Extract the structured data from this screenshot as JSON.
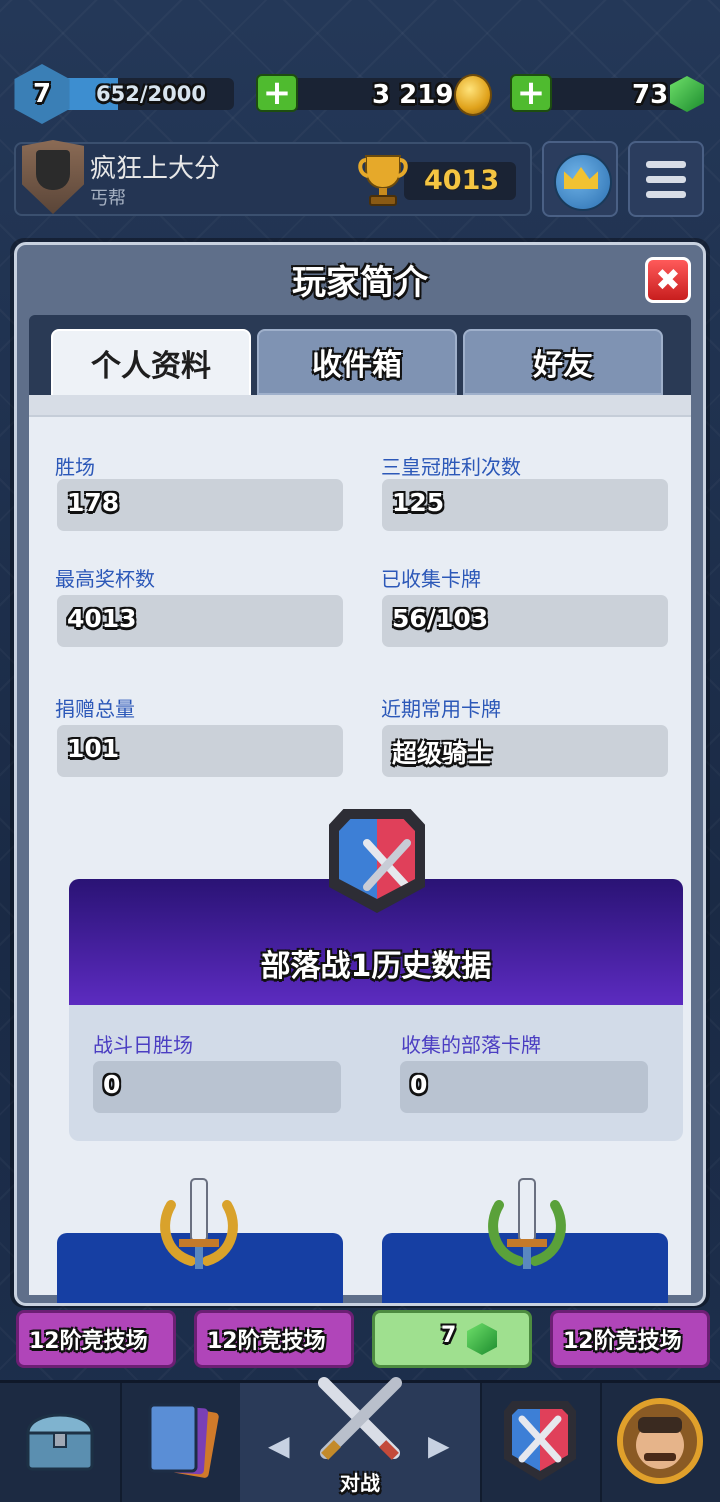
{
  "top_bar": {
    "level": "7",
    "xp": "652/2000",
    "xp_progress": 0.326,
    "gold": "3 219",
    "gems": "73",
    "add_label": "+"
  },
  "player": {
    "name": "疯狂上大分",
    "clan": "丐帮",
    "trophies": "4013"
  },
  "modal": {
    "title": "玩家简介",
    "close_label": "✖",
    "tabs": [
      {
        "label": "个人资料",
        "active": true
      },
      {
        "label": "收件箱",
        "active": false
      },
      {
        "label": "好友",
        "active": false
      }
    ]
  },
  "stats": {
    "wins_label": "胜场",
    "wins": "178",
    "three_crown_label": "三皇冠胜利次数",
    "three_crown": "125",
    "best_trophies_label": "最高奖杯数",
    "best_trophies": "4013",
    "cards_found_label": "已收集卡牌",
    "cards_found": "56/103",
    "donations_label": "捐赠总量",
    "donations": "101",
    "favorite_card_label": "近期常用卡牌",
    "favorite_card": "超级骑士"
  },
  "clan_war": {
    "title": "部落战1历史数据",
    "battle_day_wins_label": "战斗日胜场",
    "battle_day_wins": "0",
    "clan_cards_label": "收集的部落卡牌",
    "clan_cards": "0"
  },
  "behind_modal": {
    "arena_label": "12阶竞技场",
    "gem_count": "7"
  },
  "bottom_nav": {
    "battle_label": "对战"
  },
  "colors": {
    "background": "#1b2a44",
    "tab_active": "#eef2f7",
    "stat_label": "#2c58b8",
    "clan_war_header": "#3a1a95",
    "trophy_gold": "#f5c542"
  },
  "icons": [
    "level-badge-icon",
    "gold-coin-icon",
    "gem-icon",
    "trophy-icon",
    "clan-shield-icon",
    "globe-icon",
    "menu-icon",
    "close-icon",
    "clan-war-icon",
    "laurel-gold-icon",
    "laurel-green-icon",
    "chest-icon",
    "cards-icon",
    "swords-icon"
  ]
}
